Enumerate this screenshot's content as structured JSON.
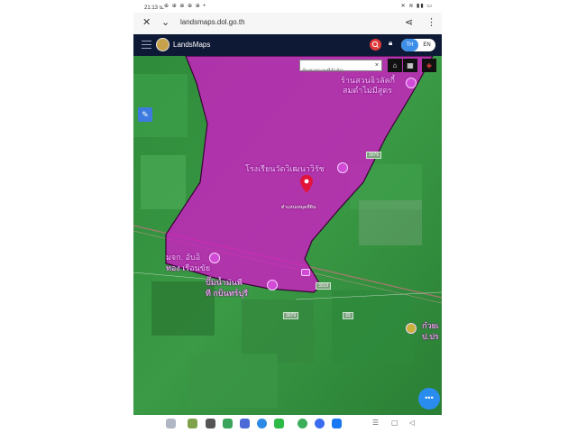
{
  "status_bar": {
    "time": "21:13 น.",
    "left_icons": "⊕ ⊕ ⊕ ⊕ ⊕ •",
    "right_icons": "✕ ≋ ▮▮ ▭"
  },
  "browser": {
    "url": "landsmaps.dol.go.th",
    "close_icon": "close-icon",
    "chevron_icon": "chevron-down-icon",
    "share_icon": "share-icon",
    "more_icon": "more-vert-icon"
  },
  "app": {
    "title": "LandsMaps",
    "lang_th": "TH",
    "lang_en": "EN"
  },
  "map": {
    "search_placeholder": "ค้นหาสถานที่สำคัญ",
    "clear_label": "×",
    "labels": {
      "shop_line1": "ร้านสวนจิวลัคกี้",
      "shop_line2": "สมดำไม่มีสูตร",
      "school": "โรงเรียนวัดวิเฒนาวิรัช",
      "pin_label": "ตำแหน่งหมุดที่ดิน",
      "left_1": "มจก. อับอิ",
      "left_2": "ทอง เรือนขัย",
      "pump_1": "ปั๊มน้ำมันพี",
      "pump_2": "ที กบินทร์บุรี",
      "right_1": "ก๋วยเ",
      "right_2": "ป.ปร"
    },
    "road_badges": [
      "3076",
      "3019",
      "3079",
      "33"
    ],
    "fab_label": "•••",
    "colors": {
      "parcel": "#d218c8",
      "field": "#2f8a3c",
      "pin": "#e3143c"
    }
  },
  "taskbar": {
    "nav_recent": "☰",
    "nav_home": "▢",
    "nav_back": "◁"
  }
}
